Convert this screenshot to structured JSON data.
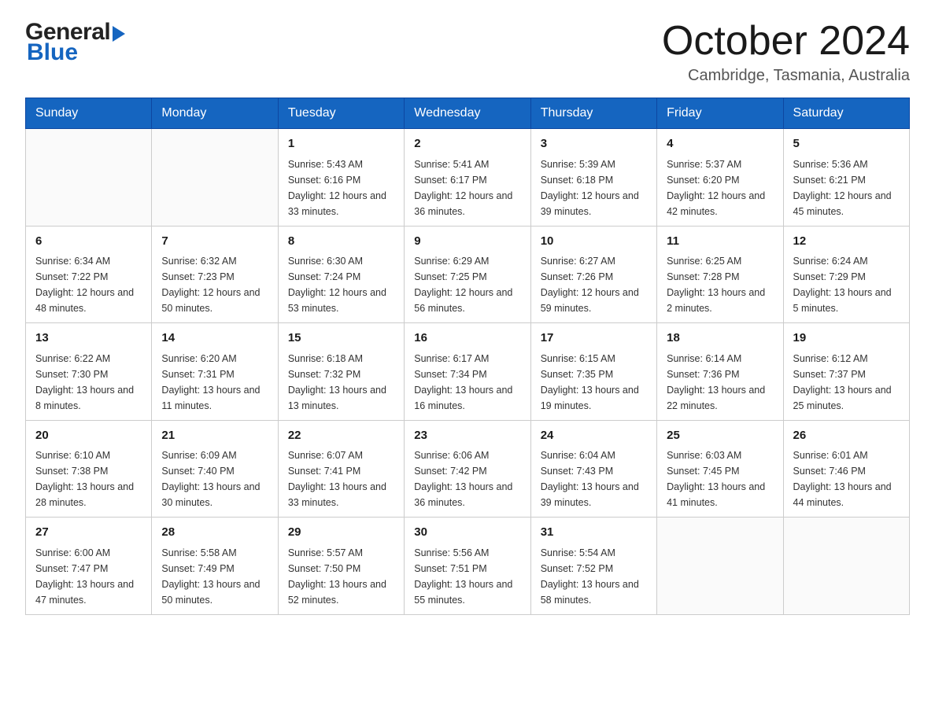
{
  "header": {
    "logo_general": "General",
    "logo_blue": "Blue",
    "title": "October 2024",
    "subtitle": "Cambridge, Tasmania, Australia"
  },
  "days_of_week": [
    "Sunday",
    "Monday",
    "Tuesday",
    "Wednesday",
    "Thursday",
    "Friday",
    "Saturday"
  ],
  "weeks": [
    [
      {
        "day": "",
        "sunrise": "",
        "sunset": "",
        "daylight": ""
      },
      {
        "day": "",
        "sunrise": "",
        "sunset": "",
        "daylight": ""
      },
      {
        "day": "1",
        "sunrise": "Sunrise: 5:43 AM",
        "sunset": "Sunset: 6:16 PM",
        "daylight": "Daylight: 12 hours and 33 minutes."
      },
      {
        "day": "2",
        "sunrise": "Sunrise: 5:41 AM",
        "sunset": "Sunset: 6:17 PM",
        "daylight": "Daylight: 12 hours and 36 minutes."
      },
      {
        "day": "3",
        "sunrise": "Sunrise: 5:39 AM",
        "sunset": "Sunset: 6:18 PM",
        "daylight": "Daylight: 12 hours and 39 minutes."
      },
      {
        "day": "4",
        "sunrise": "Sunrise: 5:37 AM",
        "sunset": "Sunset: 6:20 PM",
        "daylight": "Daylight: 12 hours and 42 minutes."
      },
      {
        "day": "5",
        "sunrise": "Sunrise: 5:36 AM",
        "sunset": "Sunset: 6:21 PM",
        "daylight": "Daylight: 12 hours and 45 minutes."
      }
    ],
    [
      {
        "day": "6",
        "sunrise": "Sunrise: 6:34 AM",
        "sunset": "Sunset: 7:22 PM",
        "daylight": "Daylight: 12 hours and 48 minutes."
      },
      {
        "day": "7",
        "sunrise": "Sunrise: 6:32 AM",
        "sunset": "Sunset: 7:23 PM",
        "daylight": "Daylight: 12 hours and 50 minutes."
      },
      {
        "day": "8",
        "sunrise": "Sunrise: 6:30 AM",
        "sunset": "Sunset: 7:24 PM",
        "daylight": "Daylight: 12 hours and 53 minutes."
      },
      {
        "day": "9",
        "sunrise": "Sunrise: 6:29 AM",
        "sunset": "Sunset: 7:25 PM",
        "daylight": "Daylight: 12 hours and 56 minutes."
      },
      {
        "day": "10",
        "sunrise": "Sunrise: 6:27 AM",
        "sunset": "Sunset: 7:26 PM",
        "daylight": "Daylight: 12 hours and 59 minutes."
      },
      {
        "day": "11",
        "sunrise": "Sunrise: 6:25 AM",
        "sunset": "Sunset: 7:28 PM",
        "daylight": "Daylight: 13 hours and 2 minutes."
      },
      {
        "day": "12",
        "sunrise": "Sunrise: 6:24 AM",
        "sunset": "Sunset: 7:29 PM",
        "daylight": "Daylight: 13 hours and 5 minutes."
      }
    ],
    [
      {
        "day": "13",
        "sunrise": "Sunrise: 6:22 AM",
        "sunset": "Sunset: 7:30 PM",
        "daylight": "Daylight: 13 hours and 8 minutes."
      },
      {
        "day": "14",
        "sunrise": "Sunrise: 6:20 AM",
        "sunset": "Sunset: 7:31 PM",
        "daylight": "Daylight: 13 hours and 11 minutes."
      },
      {
        "day": "15",
        "sunrise": "Sunrise: 6:18 AM",
        "sunset": "Sunset: 7:32 PM",
        "daylight": "Daylight: 13 hours and 13 minutes."
      },
      {
        "day": "16",
        "sunrise": "Sunrise: 6:17 AM",
        "sunset": "Sunset: 7:34 PM",
        "daylight": "Daylight: 13 hours and 16 minutes."
      },
      {
        "day": "17",
        "sunrise": "Sunrise: 6:15 AM",
        "sunset": "Sunset: 7:35 PM",
        "daylight": "Daylight: 13 hours and 19 minutes."
      },
      {
        "day": "18",
        "sunrise": "Sunrise: 6:14 AM",
        "sunset": "Sunset: 7:36 PM",
        "daylight": "Daylight: 13 hours and 22 minutes."
      },
      {
        "day": "19",
        "sunrise": "Sunrise: 6:12 AM",
        "sunset": "Sunset: 7:37 PM",
        "daylight": "Daylight: 13 hours and 25 minutes."
      }
    ],
    [
      {
        "day": "20",
        "sunrise": "Sunrise: 6:10 AM",
        "sunset": "Sunset: 7:38 PM",
        "daylight": "Daylight: 13 hours and 28 minutes."
      },
      {
        "day": "21",
        "sunrise": "Sunrise: 6:09 AM",
        "sunset": "Sunset: 7:40 PM",
        "daylight": "Daylight: 13 hours and 30 minutes."
      },
      {
        "day": "22",
        "sunrise": "Sunrise: 6:07 AM",
        "sunset": "Sunset: 7:41 PM",
        "daylight": "Daylight: 13 hours and 33 minutes."
      },
      {
        "day": "23",
        "sunrise": "Sunrise: 6:06 AM",
        "sunset": "Sunset: 7:42 PM",
        "daylight": "Daylight: 13 hours and 36 minutes."
      },
      {
        "day": "24",
        "sunrise": "Sunrise: 6:04 AM",
        "sunset": "Sunset: 7:43 PM",
        "daylight": "Daylight: 13 hours and 39 minutes."
      },
      {
        "day": "25",
        "sunrise": "Sunrise: 6:03 AM",
        "sunset": "Sunset: 7:45 PM",
        "daylight": "Daylight: 13 hours and 41 minutes."
      },
      {
        "day": "26",
        "sunrise": "Sunrise: 6:01 AM",
        "sunset": "Sunset: 7:46 PM",
        "daylight": "Daylight: 13 hours and 44 minutes."
      }
    ],
    [
      {
        "day": "27",
        "sunrise": "Sunrise: 6:00 AM",
        "sunset": "Sunset: 7:47 PM",
        "daylight": "Daylight: 13 hours and 47 minutes."
      },
      {
        "day": "28",
        "sunrise": "Sunrise: 5:58 AM",
        "sunset": "Sunset: 7:49 PM",
        "daylight": "Daylight: 13 hours and 50 minutes."
      },
      {
        "day": "29",
        "sunrise": "Sunrise: 5:57 AM",
        "sunset": "Sunset: 7:50 PM",
        "daylight": "Daylight: 13 hours and 52 minutes."
      },
      {
        "day": "30",
        "sunrise": "Sunrise: 5:56 AM",
        "sunset": "Sunset: 7:51 PM",
        "daylight": "Daylight: 13 hours and 55 minutes."
      },
      {
        "day": "31",
        "sunrise": "Sunrise: 5:54 AM",
        "sunset": "Sunset: 7:52 PM",
        "daylight": "Daylight: 13 hours and 58 minutes."
      },
      {
        "day": "",
        "sunrise": "",
        "sunset": "",
        "daylight": ""
      },
      {
        "day": "",
        "sunrise": "",
        "sunset": "",
        "daylight": ""
      }
    ]
  ]
}
